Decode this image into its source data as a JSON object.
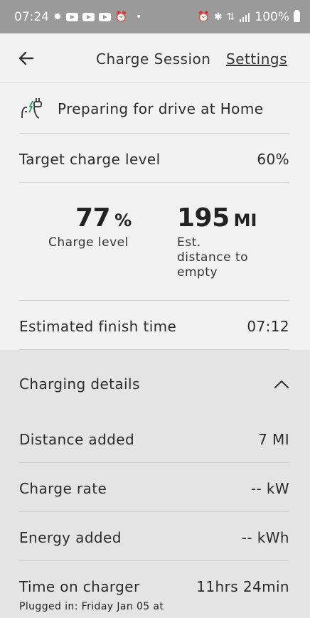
{
  "status_bar": {
    "time": "07:24",
    "battery": "100%",
    "left_icons": [
      "brightness-icon",
      "youtube-icon",
      "youtube-icon",
      "youtube-icon",
      "alarm-icon",
      "dot-icon"
    ],
    "right_icons": [
      "alarm-icon",
      "bluetooth-icon",
      "wifi-icon",
      "signal-icon",
      "battery-icon"
    ]
  },
  "header": {
    "title": "Charge Session",
    "settings_label": "Settings"
  },
  "session": {
    "status_text": "Preparing for drive at Home",
    "target_label": "Target charge level",
    "target_value": "60%",
    "charge_value": "77",
    "charge_unit": "%",
    "charge_label": "Charge level",
    "distance_value": "195",
    "distance_unit": "MI",
    "distance_label": "Est. distance to empty",
    "finish_label": "Estimated finish time",
    "finish_value": "07:12"
  },
  "details": {
    "title": "Charging details",
    "rows": [
      {
        "label": "Distance added",
        "value": "7 MI"
      },
      {
        "label": "Charge rate",
        "value": "-- kW"
      },
      {
        "label": "Energy added",
        "value": "-- kWh"
      },
      {
        "label": "Time on charger",
        "value": "11hrs 24min"
      }
    ],
    "plugged_in": "Plugged in: Friday Jan 05 at"
  },
  "colors": {
    "background": "#f2f2f2",
    "details_background": "#e4e4e4",
    "status_bar": "#9a9a9a"
  }
}
